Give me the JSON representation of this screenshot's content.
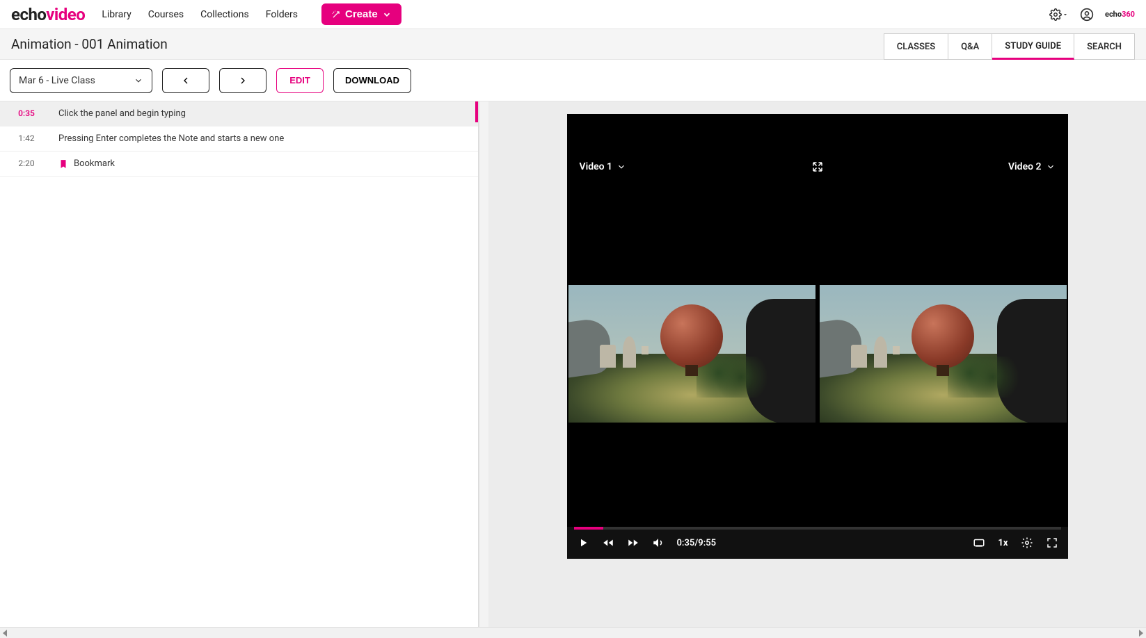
{
  "brand": {
    "part1": "echo",
    "part2": "video"
  },
  "nav": {
    "library": "Library",
    "courses": "Courses",
    "collections": "Collections",
    "folders": "Folders",
    "create": "Create"
  },
  "tinybrand": {
    "part1": "echo",
    "part2": "360"
  },
  "page": {
    "title": "Animation - 001 Animation"
  },
  "tabs": {
    "classes": "CLASSES",
    "qa": "Q&A",
    "studyguide": "STUDY GUIDE",
    "search": "SEARCH",
    "active": "studyguide"
  },
  "toolbar": {
    "class_select": "Mar 6 - Live Class",
    "edit": "EDIT",
    "download": "DOWNLOAD"
  },
  "notes": [
    {
      "ts": "0:35",
      "text": "Click the panel and begin typing",
      "active": true,
      "bookmark": false
    },
    {
      "ts": "1:42",
      "text": "Pressing Enter completes the Note and starts a new one",
      "active": false,
      "bookmark": false
    },
    {
      "ts": "2:20",
      "text": "Bookmark",
      "active": false,
      "bookmark": true
    }
  ],
  "player": {
    "video1_label": "Video 1",
    "video2_label": "Video 2",
    "time_current": "0:35",
    "time_total": "9:55",
    "speed": "1x",
    "progress_pct": 6
  }
}
